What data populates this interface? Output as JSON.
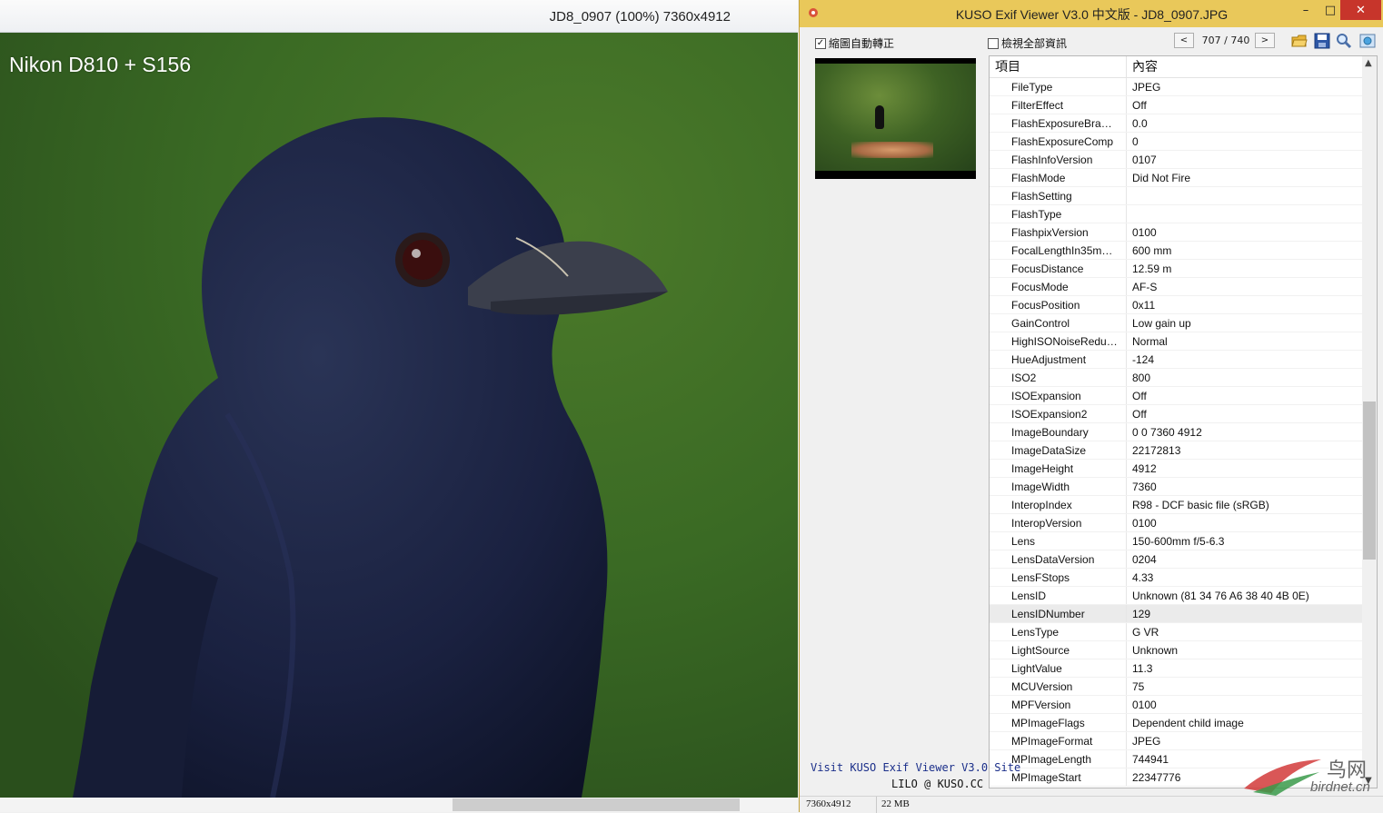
{
  "viewer": {
    "title": "JD8_0907 (100%) 7360x4912",
    "caption": "Nikon D810 + S156"
  },
  "exif_window": {
    "title": "KUSO Exif Viewer V3.0 中文版 - JD8_0907.JPG",
    "buttons": {
      "minimize": "–",
      "maximize": "□",
      "close": "✕"
    },
    "checkbox_rotate": {
      "label": "縮圖自動轉正",
      "checked": true
    },
    "checkbox_all": {
      "label": "檢視全部資訊",
      "checked": false
    },
    "nav": {
      "prev": "<",
      "next": ">",
      "page": "707 / 740"
    },
    "tools": [
      "open-folder-icon",
      "save-icon",
      "magnifier-icon",
      "web-icon"
    ],
    "table": {
      "col_item": "項目",
      "col_content": "內容",
      "rows": [
        {
          "key": "FileType",
          "value": "JPEG"
        },
        {
          "key": "FilterEffect",
          "value": "Off"
        },
        {
          "key": "FlashExposureBra…",
          "value": "0.0"
        },
        {
          "key": "FlashExposureComp",
          "value": "0"
        },
        {
          "key": "FlashInfoVersion",
          "value": "0107"
        },
        {
          "key": "FlashMode",
          "value": "Did Not Fire"
        },
        {
          "key": "FlashSetting",
          "value": ""
        },
        {
          "key": "FlashType",
          "value": ""
        },
        {
          "key": "FlashpixVersion",
          "value": "0100"
        },
        {
          "key": "FocalLengthIn35m…",
          "value": "600 mm"
        },
        {
          "key": "FocusDistance",
          "value": "12.59 m"
        },
        {
          "key": "FocusMode",
          "value": "AF-S"
        },
        {
          "key": "FocusPosition",
          "value": "0x11"
        },
        {
          "key": "GainControl",
          "value": "Low gain up"
        },
        {
          "key": "HighISONoiseRedu…",
          "value": "Normal"
        },
        {
          "key": "HueAdjustment",
          "value": "-124"
        },
        {
          "key": "ISO2",
          "value": "800"
        },
        {
          "key": "ISOExpansion",
          "value": "Off"
        },
        {
          "key": "ISOExpansion2",
          "value": "Off"
        },
        {
          "key": "ImageBoundary",
          "value": "0 0 7360 4912"
        },
        {
          "key": "ImageDataSize",
          "value": "22172813"
        },
        {
          "key": "ImageHeight",
          "value": "4912"
        },
        {
          "key": "ImageWidth",
          "value": "7360"
        },
        {
          "key": "InteropIndex",
          "value": "R98 - DCF basic file (sRGB)"
        },
        {
          "key": "InteropVersion",
          "value": "0100"
        },
        {
          "key": "Lens",
          "value": "150-600mm f/5-6.3"
        },
        {
          "key": "LensDataVersion",
          "value": "0204"
        },
        {
          "key": "LensFStops",
          "value": "4.33"
        },
        {
          "key": "LensID",
          "value": "Unknown (81 34 76 A6 38 40 4B 0E)"
        },
        {
          "key": "LensIDNumber",
          "value": "129"
        },
        {
          "key": "LensType",
          "value": "G VR"
        },
        {
          "key": "LightSource",
          "value": "Unknown"
        },
        {
          "key": "LightValue",
          "value": "11.3"
        },
        {
          "key": "MCUVersion",
          "value": "75"
        },
        {
          "key": "MPFVersion",
          "value": "0100"
        },
        {
          "key": "MPImageFlags",
          "value": "Dependent child image"
        },
        {
          "key": "MPImageFormat",
          "value": "JPEG"
        },
        {
          "key": "MPImageLength",
          "value": "744941"
        },
        {
          "key": "MPImageStart",
          "value": "22347776"
        }
      ],
      "selected_index": 29
    },
    "site_link": "Visit KUSO Exif Viewer V3.0 Site",
    "credit": "LILO @ KUSO.CC",
    "status": {
      "dimensions": "7360x4912",
      "size": "22 MB"
    }
  },
  "watermark": {
    "cn": "鸟网",
    "en": "birdnet.cn"
  }
}
